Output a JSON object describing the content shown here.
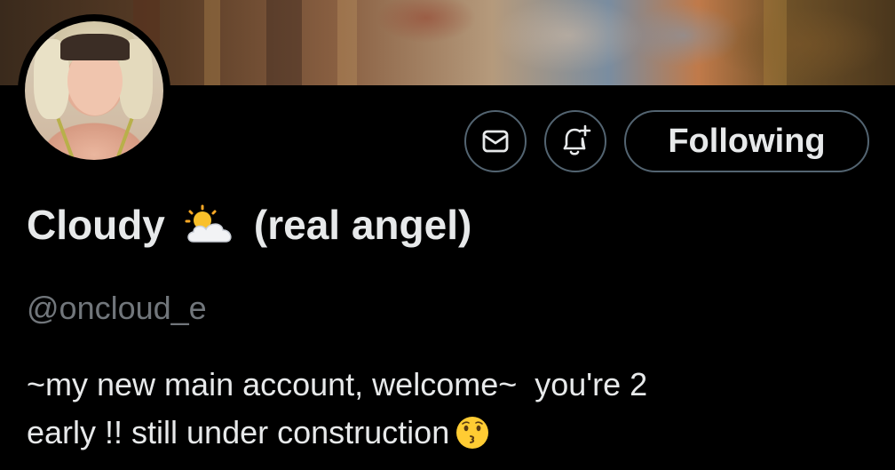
{
  "profile": {
    "banner": "painting-banner",
    "avatar": "profile-photo",
    "name": "Cloudy",
    "name_emoji": "sun-behind-cloud-emoji",
    "name_suffix": "(real angel)",
    "handle": "@oncloud_e",
    "bio_line1": "~my new main account, welcome~  you're 2",
    "bio_line2": "early !! still under construction",
    "bio_emoji": "kissing-face-emoji"
  },
  "actions": {
    "message_icon": "envelope-icon",
    "notify_icon": "bell-plus-icon",
    "follow_label": "Following"
  },
  "colors": {
    "background": "#000000",
    "text_primary": "#e7e9ea",
    "text_secondary": "#71767b",
    "button_border": "#536471"
  }
}
